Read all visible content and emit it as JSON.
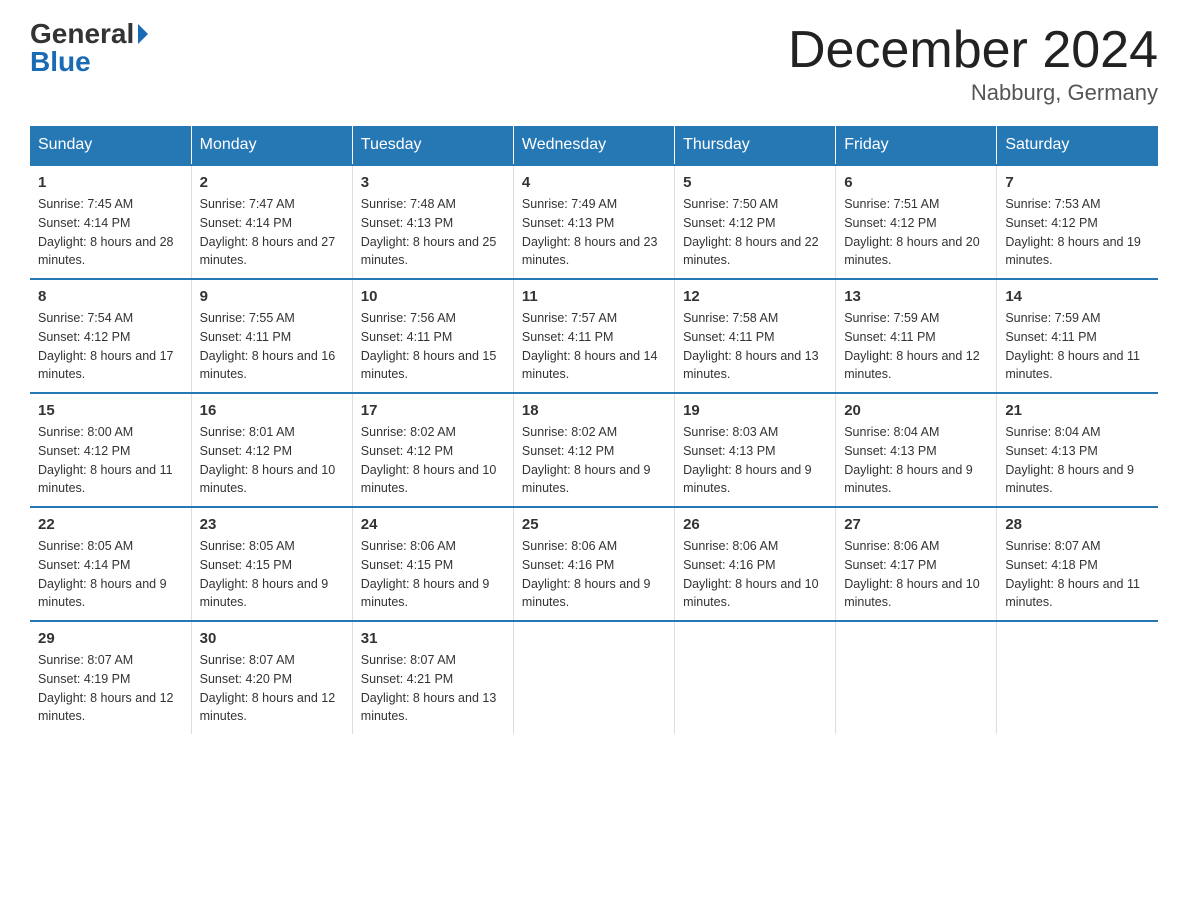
{
  "logo": {
    "general": "General",
    "blue": "Blue"
  },
  "title": "December 2024",
  "location": "Nabburg, Germany",
  "days_of_week": [
    "Sunday",
    "Monday",
    "Tuesday",
    "Wednesday",
    "Thursday",
    "Friday",
    "Saturday"
  ],
  "weeks": [
    [
      {
        "day": "1",
        "sunrise": "7:45 AM",
        "sunset": "4:14 PM",
        "daylight": "8 hours and 28 minutes."
      },
      {
        "day": "2",
        "sunrise": "7:47 AM",
        "sunset": "4:14 PM",
        "daylight": "8 hours and 27 minutes."
      },
      {
        "day": "3",
        "sunrise": "7:48 AM",
        "sunset": "4:13 PM",
        "daylight": "8 hours and 25 minutes."
      },
      {
        "day": "4",
        "sunrise": "7:49 AM",
        "sunset": "4:13 PM",
        "daylight": "8 hours and 23 minutes."
      },
      {
        "day": "5",
        "sunrise": "7:50 AM",
        "sunset": "4:12 PM",
        "daylight": "8 hours and 22 minutes."
      },
      {
        "day": "6",
        "sunrise": "7:51 AM",
        "sunset": "4:12 PM",
        "daylight": "8 hours and 20 minutes."
      },
      {
        "day": "7",
        "sunrise": "7:53 AM",
        "sunset": "4:12 PM",
        "daylight": "8 hours and 19 minutes."
      }
    ],
    [
      {
        "day": "8",
        "sunrise": "7:54 AM",
        "sunset": "4:12 PM",
        "daylight": "8 hours and 17 minutes."
      },
      {
        "day": "9",
        "sunrise": "7:55 AM",
        "sunset": "4:11 PM",
        "daylight": "8 hours and 16 minutes."
      },
      {
        "day": "10",
        "sunrise": "7:56 AM",
        "sunset": "4:11 PM",
        "daylight": "8 hours and 15 minutes."
      },
      {
        "day": "11",
        "sunrise": "7:57 AM",
        "sunset": "4:11 PM",
        "daylight": "8 hours and 14 minutes."
      },
      {
        "day": "12",
        "sunrise": "7:58 AM",
        "sunset": "4:11 PM",
        "daylight": "8 hours and 13 minutes."
      },
      {
        "day": "13",
        "sunrise": "7:59 AM",
        "sunset": "4:11 PM",
        "daylight": "8 hours and 12 minutes."
      },
      {
        "day": "14",
        "sunrise": "7:59 AM",
        "sunset": "4:11 PM",
        "daylight": "8 hours and 11 minutes."
      }
    ],
    [
      {
        "day": "15",
        "sunrise": "8:00 AM",
        "sunset": "4:12 PM",
        "daylight": "8 hours and 11 minutes."
      },
      {
        "day": "16",
        "sunrise": "8:01 AM",
        "sunset": "4:12 PM",
        "daylight": "8 hours and 10 minutes."
      },
      {
        "day": "17",
        "sunrise": "8:02 AM",
        "sunset": "4:12 PM",
        "daylight": "8 hours and 10 minutes."
      },
      {
        "day": "18",
        "sunrise": "8:02 AM",
        "sunset": "4:12 PM",
        "daylight": "8 hours and 9 minutes."
      },
      {
        "day": "19",
        "sunrise": "8:03 AM",
        "sunset": "4:13 PM",
        "daylight": "8 hours and 9 minutes."
      },
      {
        "day": "20",
        "sunrise": "8:04 AM",
        "sunset": "4:13 PM",
        "daylight": "8 hours and 9 minutes."
      },
      {
        "day": "21",
        "sunrise": "8:04 AM",
        "sunset": "4:13 PM",
        "daylight": "8 hours and 9 minutes."
      }
    ],
    [
      {
        "day": "22",
        "sunrise": "8:05 AM",
        "sunset": "4:14 PM",
        "daylight": "8 hours and 9 minutes."
      },
      {
        "day": "23",
        "sunrise": "8:05 AM",
        "sunset": "4:15 PM",
        "daylight": "8 hours and 9 minutes."
      },
      {
        "day": "24",
        "sunrise": "8:06 AM",
        "sunset": "4:15 PM",
        "daylight": "8 hours and 9 minutes."
      },
      {
        "day": "25",
        "sunrise": "8:06 AM",
        "sunset": "4:16 PM",
        "daylight": "8 hours and 9 minutes."
      },
      {
        "day": "26",
        "sunrise": "8:06 AM",
        "sunset": "4:16 PM",
        "daylight": "8 hours and 10 minutes."
      },
      {
        "day": "27",
        "sunrise": "8:06 AM",
        "sunset": "4:17 PM",
        "daylight": "8 hours and 10 minutes."
      },
      {
        "day": "28",
        "sunrise": "8:07 AM",
        "sunset": "4:18 PM",
        "daylight": "8 hours and 11 minutes."
      }
    ],
    [
      {
        "day": "29",
        "sunrise": "8:07 AM",
        "sunset": "4:19 PM",
        "daylight": "8 hours and 12 minutes."
      },
      {
        "day": "30",
        "sunrise": "8:07 AM",
        "sunset": "4:20 PM",
        "daylight": "8 hours and 12 minutes."
      },
      {
        "day": "31",
        "sunrise": "8:07 AM",
        "sunset": "4:21 PM",
        "daylight": "8 hours and 13 minutes."
      },
      null,
      null,
      null,
      null
    ]
  ]
}
